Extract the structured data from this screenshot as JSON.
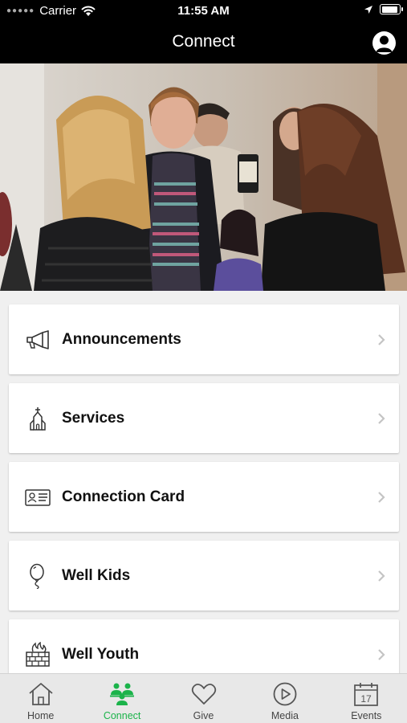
{
  "status_bar": {
    "carrier": "Carrier",
    "time": "11:55 AM",
    "battery_level": 0.95
  },
  "nav": {
    "title": "Connect"
  },
  "menu": [
    {
      "label": "Announcements",
      "icon": "megaphone-icon"
    },
    {
      "label": "Services",
      "icon": "church-icon"
    },
    {
      "label": "Connection Card",
      "icon": "id-card-icon"
    },
    {
      "label": "Well Kids",
      "icon": "balloon-icon"
    },
    {
      "label": "Well Youth",
      "icon": "brick-wall-fire-icon"
    }
  ],
  "tabs": [
    {
      "label": "Home",
      "icon": "house-icon"
    },
    {
      "label": "Connect",
      "icon": "people-group-icon",
      "active": true
    },
    {
      "label": "Give",
      "icon": "heart-icon"
    },
    {
      "label": "Media",
      "icon": "play-circle-icon"
    },
    {
      "label": "Events",
      "icon": "calendar-icon",
      "day": "17"
    }
  ],
  "colors": {
    "accent": "#1bb34a",
    "bar": "#000000",
    "tab_bg": "#e8e8e8"
  }
}
